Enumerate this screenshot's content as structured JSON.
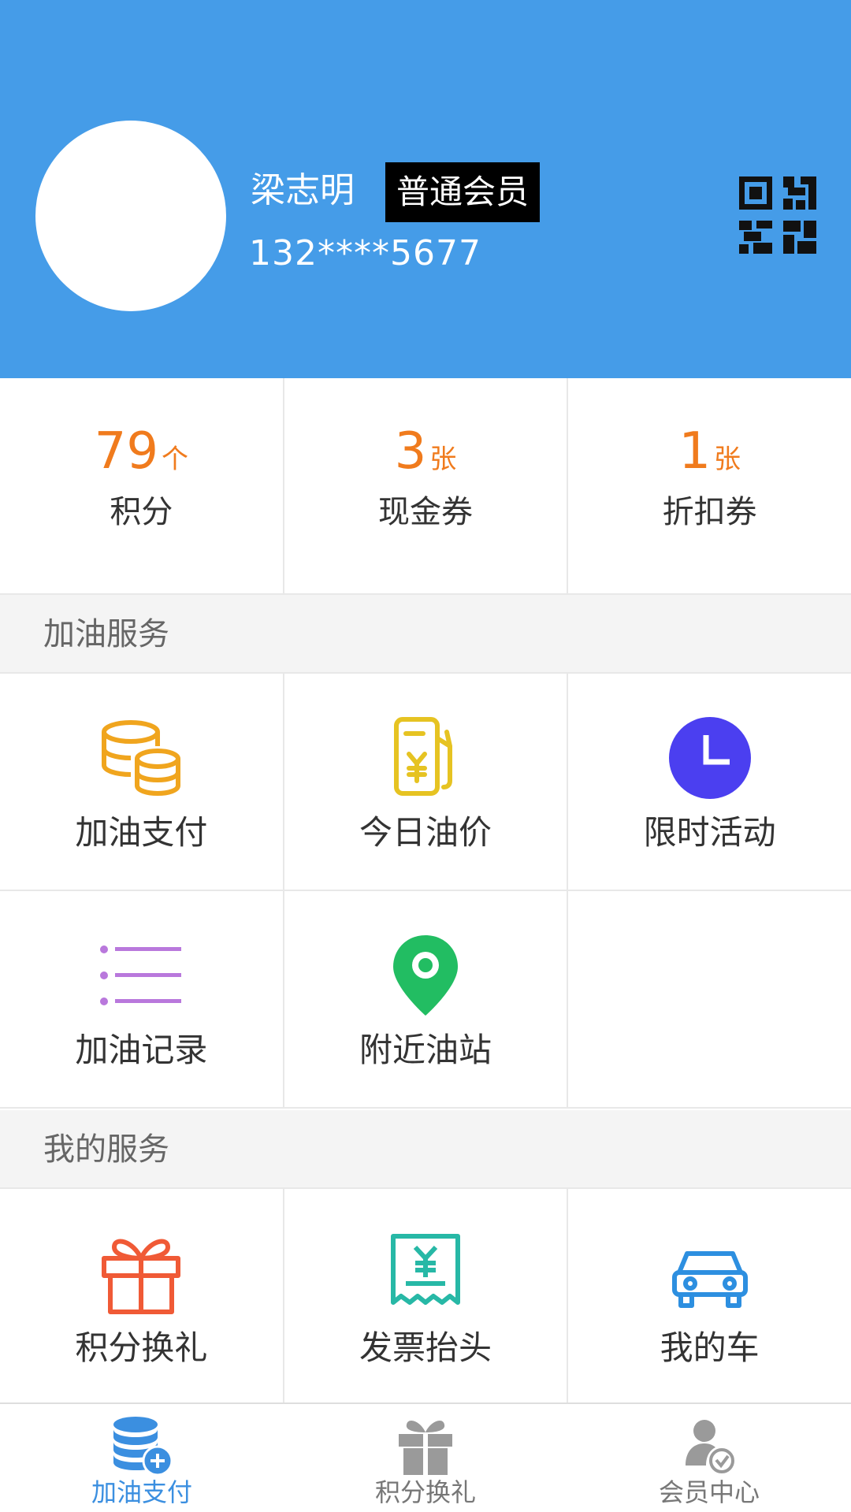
{
  "header": {
    "user_name": "梁志明",
    "member_level": "普通会员",
    "phone": "132****5677"
  },
  "stats": [
    {
      "value": "79",
      "unit": "个",
      "label": "积分"
    },
    {
      "value": "3",
      "unit": "张",
      "label": "现金券"
    },
    {
      "value": "1",
      "unit": "张",
      "label": "折扣券"
    }
  ],
  "fuel_service": {
    "title": "加油服务",
    "items": [
      {
        "label": "加油支付",
        "icon": "coins-icon"
      },
      {
        "label": "今日油价",
        "icon": "fuel-pump-icon"
      },
      {
        "label": "限时活动",
        "icon": "clock-icon"
      },
      {
        "label": "加油记录",
        "icon": "list-icon"
      },
      {
        "label": "附近油站",
        "icon": "map-pin-icon"
      }
    ]
  },
  "my_service": {
    "title": "我的服务",
    "items": [
      {
        "label": "积分换礼",
        "icon": "gift-icon"
      },
      {
        "label": "发票抬头",
        "icon": "invoice-icon"
      },
      {
        "label": "我的车",
        "icon": "car-icon"
      }
    ]
  },
  "tabbar": {
    "active_index": 0,
    "tabs": [
      {
        "label": "加油支付",
        "icon": "coins-plus-icon"
      },
      {
        "label": "积分换礼",
        "icon": "gift-icon"
      },
      {
        "label": "会员中心",
        "icon": "member-icon"
      }
    ]
  },
  "colors": {
    "header_bg": "#459ce8",
    "accent_orange": "#f07b1d",
    "tab_active": "#3b8fe0"
  }
}
